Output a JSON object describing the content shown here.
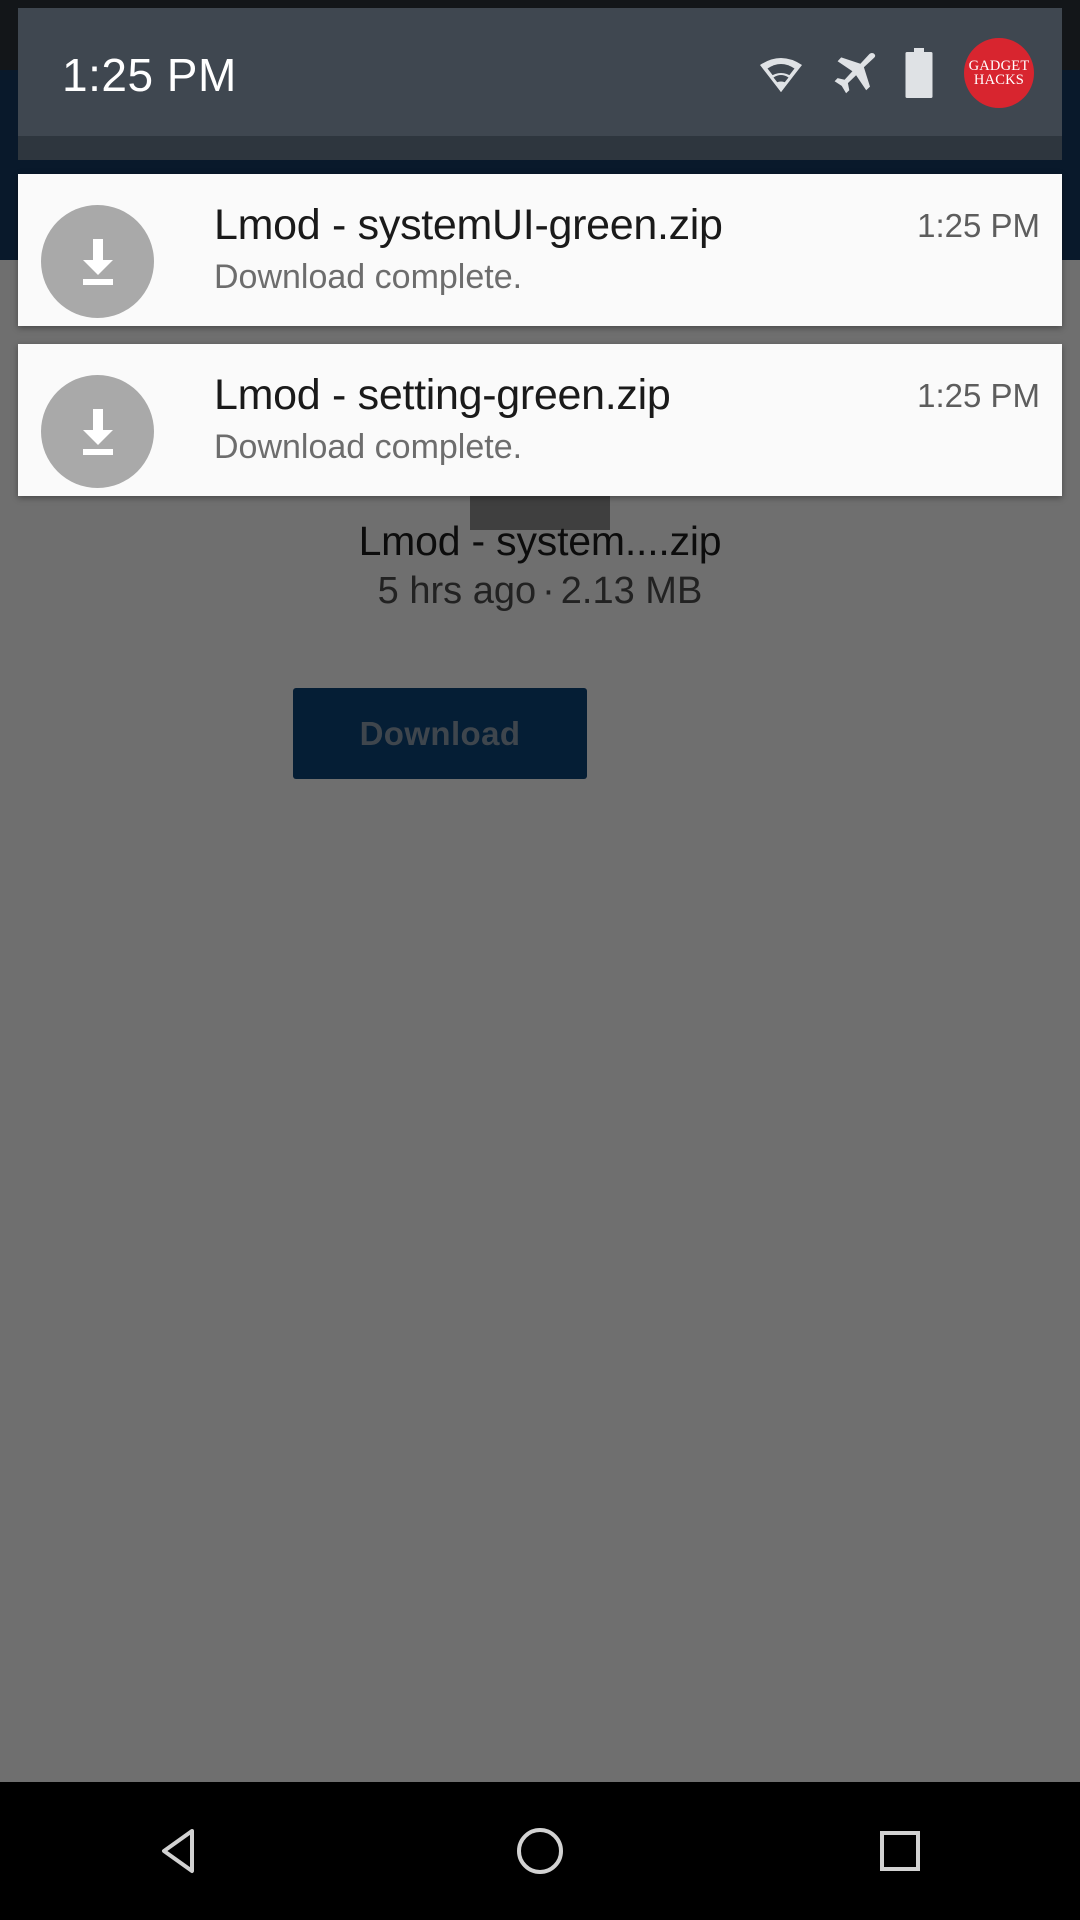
{
  "status_bar": {
    "clock": "1:25 PM",
    "icons": [
      {
        "name": "wifi-icon",
        "label": "Wi-Fi"
      },
      {
        "name": "airplane-mode-icon",
        "label": "Airplane mode"
      },
      {
        "name": "battery-icon",
        "label": "Battery full"
      }
    ],
    "badge": {
      "name": "gadget-hacks-logo",
      "line1": "GADGET",
      "line2": "HACKS",
      "color": "#d8252f"
    },
    "background_color": "#3f4750"
  },
  "notifications": [
    {
      "icon": "download-complete-icon",
      "title": "Lmod - systemUI-green.zip",
      "subtitle": "Download complete.",
      "time": "1:25 PM"
    },
    {
      "icon": "download-complete-icon",
      "title": "Lmod - setting-green.zip",
      "subtitle": "Download complete.",
      "time": "1:25 PM"
    }
  ],
  "behind_app": {
    "file_name": "Lmod - system....zip",
    "file_age": "5 hrs ago",
    "file_separator": "·",
    "file_size": "2.13 MB",
    "download_button": "Download",
    "download_button_color": "#0d4377"
  },
  "nav_bar": {
    "back_label": "Back",
    "home_label": "Home",
    "recents_label": "Recent apps"
  }
}
